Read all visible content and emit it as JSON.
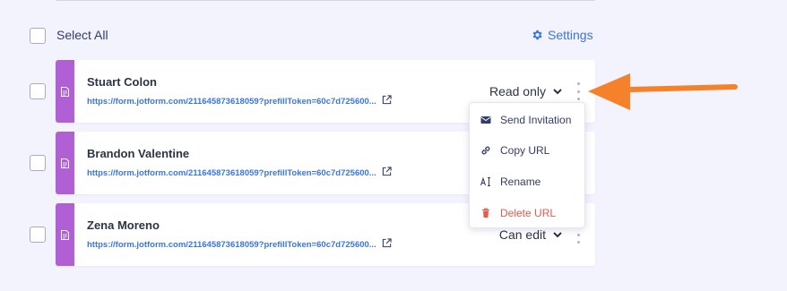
{
  "toolbar": {
    "select_all_label": "Select All",
    "settings_label": "Settings"
  },
  "users": [
    {
      "name": "Stuart Colon",
      "url": "https://form.jotform.com/211645873618059?prefillToken=60c7d725600...",
      "permission": "Read only"
    },
    {
      "name": "Brandon Valentine",
      "url": "https://form.jotform.com/211645873618059?prefillToken=60c7d725600...",
      "permission": ""
    },
    {
      "name": "Zena Moreno",
      "url": "https://form.jotform.com/211645873618059?prefillToken=60c7d725600...",
      "permission": "Can edit"
    }
  ],
  "menu": {
    "items": [
      {
        "label": "Send Invitation",
        "icon": "envelope-icon"
      },
      {
        "label": "Copy URL",
        "icon": "link-icon"
      },
      {
        "label": "Rename",
        "icon": "rename-icon"
      },
      {
        "label": "Delete URL",
        "icon": "trash-icon"
      }
    ]
  },
  "colors": {
    "accent": "#3a74e8",
    "form_strip": "#b15fd5",
    "danger": "#e55a4a",
    "annotation_arrow": "#f5822a"
  }
}
